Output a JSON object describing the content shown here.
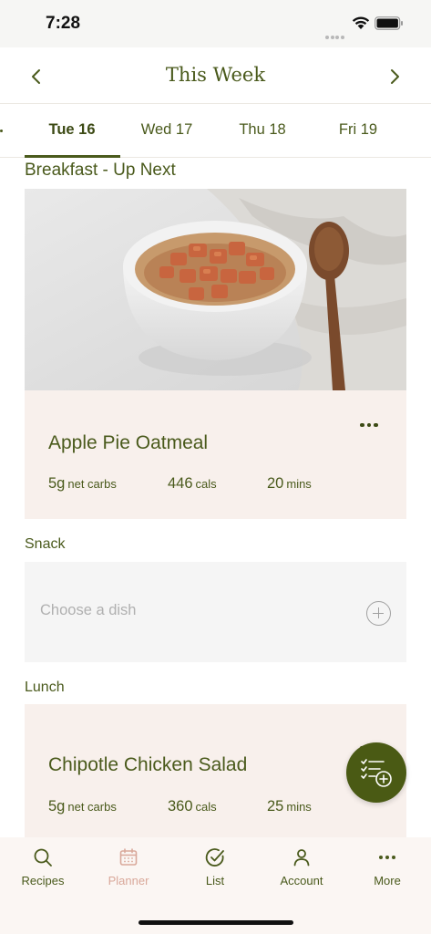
{
  "status_bar": {
    "time": "7:28"
  },
  "header": {
    "title": "This Week",
    "prev_icon": "chevron-left-icon",
    "next_icon": "chevron-right-icon"
  },
  "day_tabs": [
    {
      "label": "Tue 16",
      "active": true
    },
    {
      "label": "Wed 17",
      "active": false
    },
    {
      "label": "Thu 18",
      "active": false
    },
    {
      "label": "Fri 19",
      "active": false
    }
  ],
  "breakfast": {
    "section_label": "Breakfast - Up Next",
    "title": "Apple Pie Oatmeal",
    "carbs_value": "5g",
    "carbs_unit": "net carbs",
    "cals_value": "446",
    "cals_unit": "cals",
    "time_value": "20",
    "time_unit": "mins"
  },
  "snack": {
    "section_label": "Snack",
    "placeholder": "Choose a dish"
  },
  "lunch": {
    "section_label": "Lunch",
    "title": "Chipotle Chicken Salad",
    "carbs_value": "5g",
    "carbs_unit": "net carbs",
    "cals_value": "360",
    "cals_unit": "cals",
    "time_value": "25",
    "time_unit": "mins"
  },
  "tab_bar": [
    {
      "label": "Recipes",
      "icon": "search-icon",
      "active": false
    },
    {
      "label": "Planner",
      "icon": "calendar-icon",
      "active": true
    },
    {
      "label": "List",
      "icon": "check-circle-icon",
      "active": false
    },
    {
      "label": "Account",
      "icon": "person-icon",
      "active": false
    },
    {
      "label": "More",
      "icon": "more-dots-icon",
      "active": false
    }
  ],
  "colors": {
    "accent": "#4a5a1c",
    "card_bg": "#f8f0ec",
    "tab_active": "#d9a89a",
    "fab": "#4a5a14"
  }
}
